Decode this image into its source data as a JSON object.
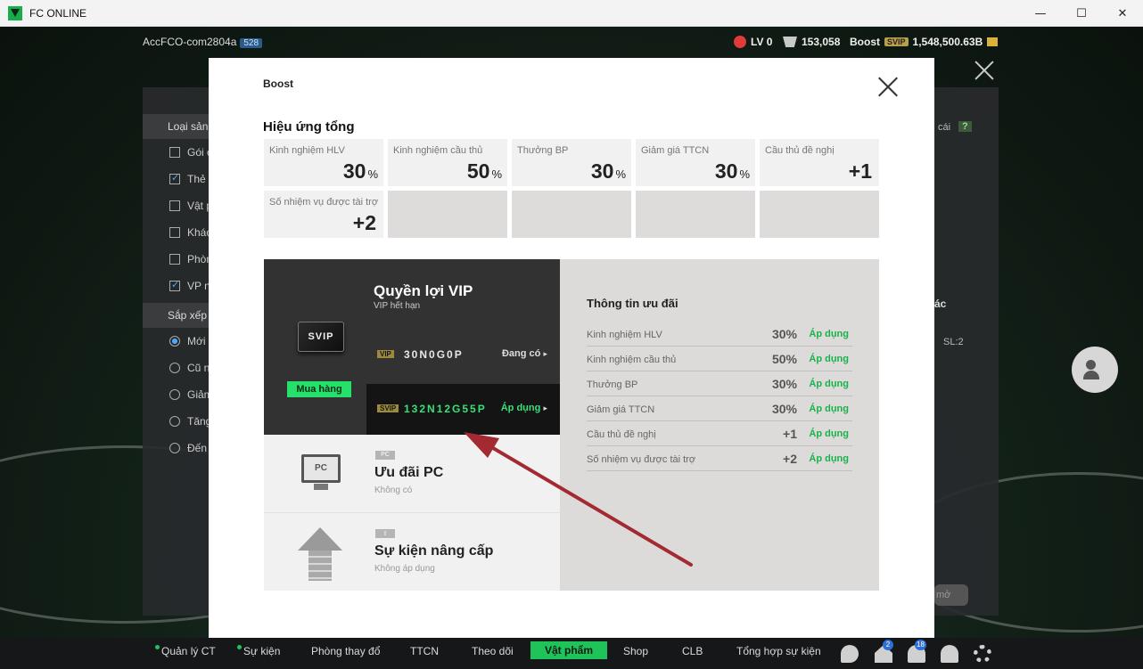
{
  "window": {
    "title": "FC ONLINE",
    "minimize": "—",
    "maximize": "☐",
    "close": "✕"
  },
  "topbar": {
    "account": "AccFCO-com2804a",
    "account_badge": "528",
    "level": "LV 0",
    "bp": "153,058",
    "boost_label": "Boost",
    "boost_tier": "SVIP",
    "coins": "1,548,500.63B"
  },
  "background_panel": {
    "filter_header": "Loại sản p",
    "filters": [
      {
        "label": "Gói c",
        "checked": false
      },
      {
        "label": "Thẻ",
        "checked": true
      },
      {
        "label": "Vật p",
        "checked": false
      },
      {
        "label": "Khác",
        "checked": false
      },
      {
        "label": "Phòn",
        "checked": false
      },
      {
        "label": "VP nâ",
        "checked": true
      }
    ],
    "sort_header": "Sắp xếp v",
    "sorts": [
      {
        "label": "Mới n",
        "selected": true
      },
      {
        "label": "Cũ nh",
        "selected": false
      },
      {
        "label": "Giảm",
        "selected": false
      },
      {
        "label": "Tăng",
        "selected": false
      },
      {
        "label": "Đến n",
        "selected": false
      }
    ],
    "fragments": {
      "top_right": "cái",
      "help": "?",
      "mid_right": "ác",
      "slot": "SL:2",
      "bottom_btn": "mở"
    }
  },
  "modal": {
    "title": "Boost",
    "section_title": "Hiệu ứng tổng",
    "effects": [
      {
        "label": "Kinh nghiệm HLV",
        "value": "30",
        "unit": "%"
      },
      {
        "label": "Kinh nghiệm cầu thủ",
        "value": "50",
        "unit": "%"
      },
      {
        "label": "Thưởng BP",
        "value": "30",
        "unit": "%"
      },
      {
        "label": "Giảm giá TTCN",
        "value": "30",
        "unit": "%"
      },
      {
        "label": "Cầu thủ đề nghị",
        "value": "+1",
        "unit": ""
      },
      {
        "label": "Số nhiệm vụ được tài trợ",
        "value": "+2",
        "unit": ""
      }
    ],
    "vip": {
      "title": "Quyền lợi VIP",
      "subtitle": "VIP hết hạn",
      "card_text": "SVIP",
      "buy_label": "Mua hàng",
      "rows": [
        {
          "tag": "VIP",
          "code": "30N0G0P",
          "status": "Đang có",
          "selected": false
        },
        {
          "tag": "SVIP",
          "code": "132N12G55P",
          "status": "Áp dụng",
          "selected": true
        }
      ]
    },
    "pc": {
      "tag": "PC",
      "title": "Ưu đãi PC",
      "subtitle": "Không có",
      "icon_text": "PC"
    },
    "upgrade": {
      "tag": "⇧",
      "title": "Sự kiện nâng cấp",
      "subtitle": "Không áp dụng"
    },
    "info": {
      "title": "Thông tin ưu đãi",
      "rows": [
        {
          "name": "Kinh nghiệm HLV",
          "value": "30%",
          "action": "Áp dụng"
        },
        {
          "name": "Kinh nghiệm cầu thủ",
          "value": "50%",
          "action": "Áp dụng"
        },
        {
          "name": "Thưởng BP",
          "value": "30%",
          "action": "Áp dụng"
        },
        {
          "name": "Giảm giá TTCN",
          "value": "30%",
          "action": "Áp dụng"
        },
        {
          "name": "Cầu thủ đề nghị",
          "value": "+1",
          "action": "Áp dụng"
        },
        {
          "name": "Số nhiệm vụ được tài trợ",
          "value": "+2",
          "action": "Áp dụng"
        }
      ]
    }
  },
  "bottom_nav": {
    "items": [
      "Quản lý CT",
      "Sự kiện",
      "Phòng thay đổ",
      "TTCN",
      "Theo dõi",
      "Vật phẩm",
      "Shop",
      "CLB",
      "Tổng hợp sự kiện"
    ],
    "active": "Vật phẩm",
    "badges": {
      "home": "2",
      "bell": "18"
    }
  },
  "colors": {
    "accent_green": "#20c25a",
    "apply_green": "#19b24a",
    "annotation_arrow": "#a32a33",
    "vip_dark": "#333233"
  }
}
